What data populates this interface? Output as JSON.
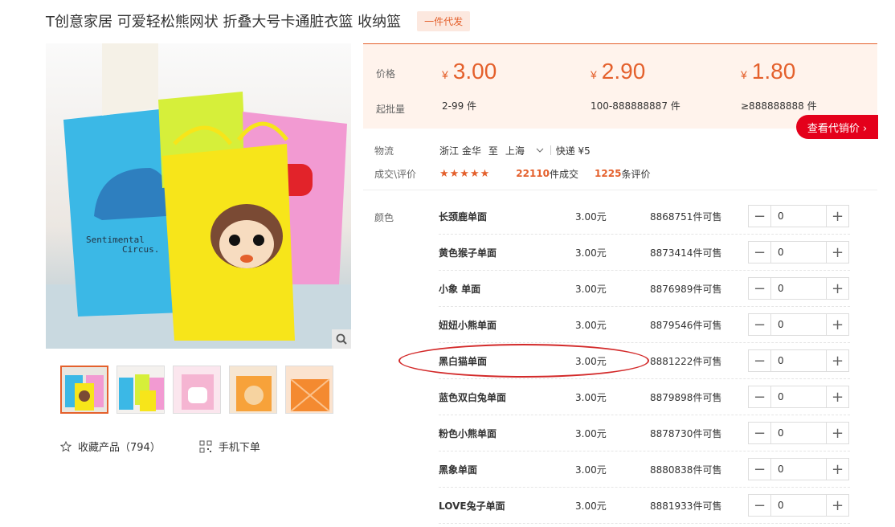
{
  "product": {
    "title": "T创意家居 可爱轻松熊网状 折叠大号卡通脏衣篮 收纳篮",
    "badge": "一件代发"
  },
  "gallery": {
    "thumb_count": 5,
    "actions": {
      "favorite": "收藏产品（794）",
      "mobile_order": "手机下单"
    }
  },
  "pricing": {
    "price_label": "价格",
    "moq_label": "起批量",
    "tiers": [
      {
        "currency": "¥",
        "price": "3.00",
        "range": "2-99 件"
      },
      {
        "currency": "¥",
        "price": "2.90",
        "range": "100-888888887 件"
      },
      {
        "currency": "¥",
        "price": "1.80",
        "range": "≥888888888 件"
      }
    ],
    "agent_button": "查看代销价 ›"
  },
  "logistics": {
    "label": "物流",
    "from": "浙江 金华",
    "to_word": "至",
    "to": "上海",
    "express": "快递 ¥5",
    "deal_label": "成交\\评价",
    "stars": "★★★★★",
    "deals_count": "22110",
    "deals_suffix": "件成交",
    "reviews_count": "1225",
    "reviews_suffix": "条评价"
  },
  "sku": {
    "color_label": "颜色",
    "items": [
      {
        "name": "长颈鹿单面",
        "price": "3.00元",
        "stock": "8868751件可售",
        "qty": "0"
      },
      {
        "name": "黄色猴子单面",
        "price": "3.00元",
        "stock": "8873414件可售",
        "qty": "0"
      },
      {
        "name": "小象 单面",
        "price": "3.00元",
        "stock": "8876989件可售",
        "qty": "0"
      },
      {
        "name": "妞妞小熊单面",
        "price": "3.00元",
        "stock": "8879546件可售",
        "qty": "0"
      },
      {
        "name": "黑白猫单面",
        "price": "3.00元",
        "stock": "8881222件可售",
        "qty": "0"
      },
      {
        "name": "蓝色双白兔单面",
        "price": "3.00元",
        "stock": "8879898件可售",
        "qty": "0"
      },
      {
        "name": "粉色小熊单面",
        "price": "3.00元",
        "stock": "8878730件可售",
        "qty": "0"
      },
      {
        "name": "黑象单面",
        "price": "3.00元",
        "stock": "8880838件可售",
        "qty": "0"
      },
      {
        "name": "LOVE兔子单面",
        "price": "3.00元",
        "stock": "8881933件可售",
        "qty": "0"
      }
    ]
  },
  "colors": {
    "accent": "#e4602c",
    "agent_button": "#e4001b",
    "annotation": "#d32a2a"
  }
}
